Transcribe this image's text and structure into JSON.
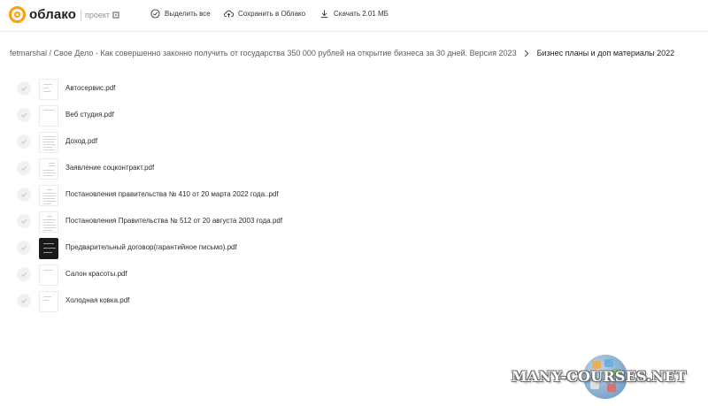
{
  "header": {
    "logo_text": "облако",
    "project_label": "проект",
    "actions": {
      "select_all": "Выделить все",
      "save_to_cloud": "Сохранить в Облако",
      "download": "Скачать 2.01 МБ"
    }
  },
  "breadcrumb": {
    "path": "fetmarshal / Свое Дело - Как совершенно законно получить от государства 350 000 рублей на открытие бизнеса за 30 дней. Версия 2023",
    "current": "Бизнес планы и доп материалы 2022"
  },
  "files": [
    {
      "name": "Автосервис.pdf"
    },
    {
      "name": "Веб студия.pdf"
    },
    {
      "name": "Доход.pdf"
    },
    {
      "name": "Заявление соцконтракт.pdf"
    },
    {
      "name": "Постановления правительства № 410 от 20 марта 2022 года..pdf"
    },
    {
      "name": "Постановления Правительства № 512 от 20 августа 2003 года.pdf"
    },
    {
      "name": "Предварительный договор(гарантийное письмо).pdf"
    },
    {
      "name": "Салон красоты.pdf"
    },
    {
      "name": "Холодная ковка.pdf"
    }
  ],
  "watermark": {
    "text": "MANY-COURSES.NET"
  },
  "colors": {
    "brand": "#ff9e00",
    "check_bg": "#f0f1f3",
    "text": "#2c2d2e"
  },
  "icons": {
    "select_all": "check-circle-icon",
    "save": "cloud-upload-icon",
    "download": "download-icon",
    "row_check": "check-icon",
    "breadcrumb": "chevron-right-icon"
  }
}
